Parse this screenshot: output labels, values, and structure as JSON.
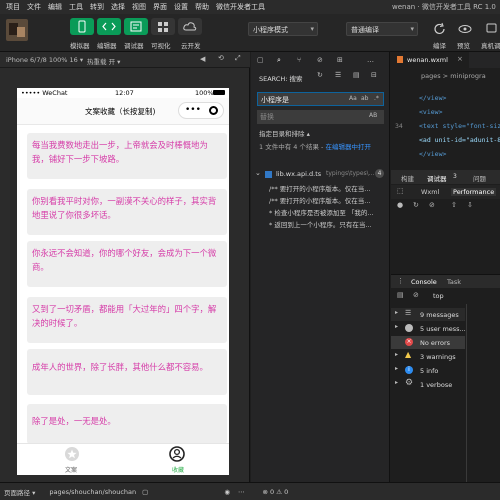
{
  "menubar": {
    "items": [
      "项目",
      "文件",
      "编辑",
      "工具",
      "转到",
      "选择",
      "视图",
      "界面",
      "设置",
      "帮助",
      "微信开发者工具"
    ],
    "window_title": "wenan · 微信开发者工具 RC 1.06"
  },
  "toolbar": {
    "buttons": [
      "模拟器",
      "编辑器",
      "调试器",
      "可视化",
      "云开发"
    ],
    "mode": "小程序模式",
    "compile": "普通编译",
    "right_labels": [
      "编译",
      "预览",
      "真机调"
    ]
  },
  "simulator": {
    "device": "iPhone 6/7/8 100% 16 ▾",
    "hot_reload": "热重载 开 ▾",
    "carrier": "••••• WeChat",
    "time": "12:07",
    "battery": "100%",
    "nav_title": "文案收藏（长按复制)",
    "cards": [
      "每当我费数地走出一步，上帝就会及时棒慨地为我，铺好下一步下坡路。",
      "你别看我平时对你，一副漠不关心的样子，其实背地里说了你很多坏话。",
      "你永远不会知道，你的哪个好友，会成为下一个微商。",
      "又到了一切矛盾，都能用「大过年的」四个字，解决的时候了。",
      "成年人的世界，除了长胖，其他什么都不容易。",
      "除了是处，一无是处。"
    ],
    "tabs": [
      "文案",
      "收藏"
    ]
  },
  "search": {
    "header": "SEARCH: 搜索",
    "query": "小程序是",
    "replace_placeholder": "替换",
    "opt1": "Aa",
    "opt2": "ab",
    "opt3": ".*",
    "replace_opt": "AB",
    "filter_toggle": "指定目录和排除 ▴",
    "summary_prefix": "1 文件中有 4 个结果 - ",
    "summary_link": "在编辑器中打开",
    "file_name": "lib.wx.api.d.ts",
    "file_path": "typings\\types\\...",
    "result_count": "4",
    "results": [
      "/** 要打开的小程序版本。仅在当...",
      "/** 要打开的小程序版本。仅在当...",
      "* 检查小程序是否被添加至 「我的...",
      "* 返回到上一个小程序。只有在当..."
    ]
  },
  "editor": {
    "tab": "wenan.wxml",
    "breadcrumb": "pages > miniprogra",
    "lines": [
      {
        "no": "",
        "text": "</view>"
      },
      {
        "no": "",
        "text": "<view>"
      },
      {
        "no": "34",
        "text": "<text style=\"font-siz"
      },
      {
        "no": "",
        "text": "<ad unit-id=\"adunit-8a"
      },
      {
        "no": "",
        "text": "</view>"
      }
    ]
  },
  "devtools": {
    "tabs": [
      "构建",
      "调试器",
      "3",
      "问题"
    ],
    "subtabs": [
      "Wxml",
      "Performance"
    ],
    "console_tabs": [
      "Console",
      "Task"
    ],
    "context": "top",
    "filters": [
      {
        "icon": "list-icon",
        "label": "9 messages",
        "color": "#bbbbbb"
      },
      {
        "icon": "user-icon",
        "label": "5 user mess...",
        "color": "#bbbbbb"
      },
      {
        "icon": "error-icon",
        "label": "No errors",
        "color": "#e24a4a"
      },
      {
        "icon": "warning-icon",
        "label": "3 warnings",
        "color": "#f2c94c"
      },
      {
        "icon": "info-icon",
        "label": "5 info",
        "color": "#2d8cf0"
      },
      {
        "icon": "gear-icon",
        "label": "1 verbose",
        "color": "#bbbbbb"
      }
    ]
  },
  "bottombar": {
    "path_label": "页面路径 ▾",
    "path": "pages/shouchan/shouchan",
    "counts": "⊗ 0 ⚠ 0"
  },
  "colors": {
    "accent": "#0a9b58",
    "card_text": "#d63ca8",
    "card_bg": "#eeeeee"
  }
}
